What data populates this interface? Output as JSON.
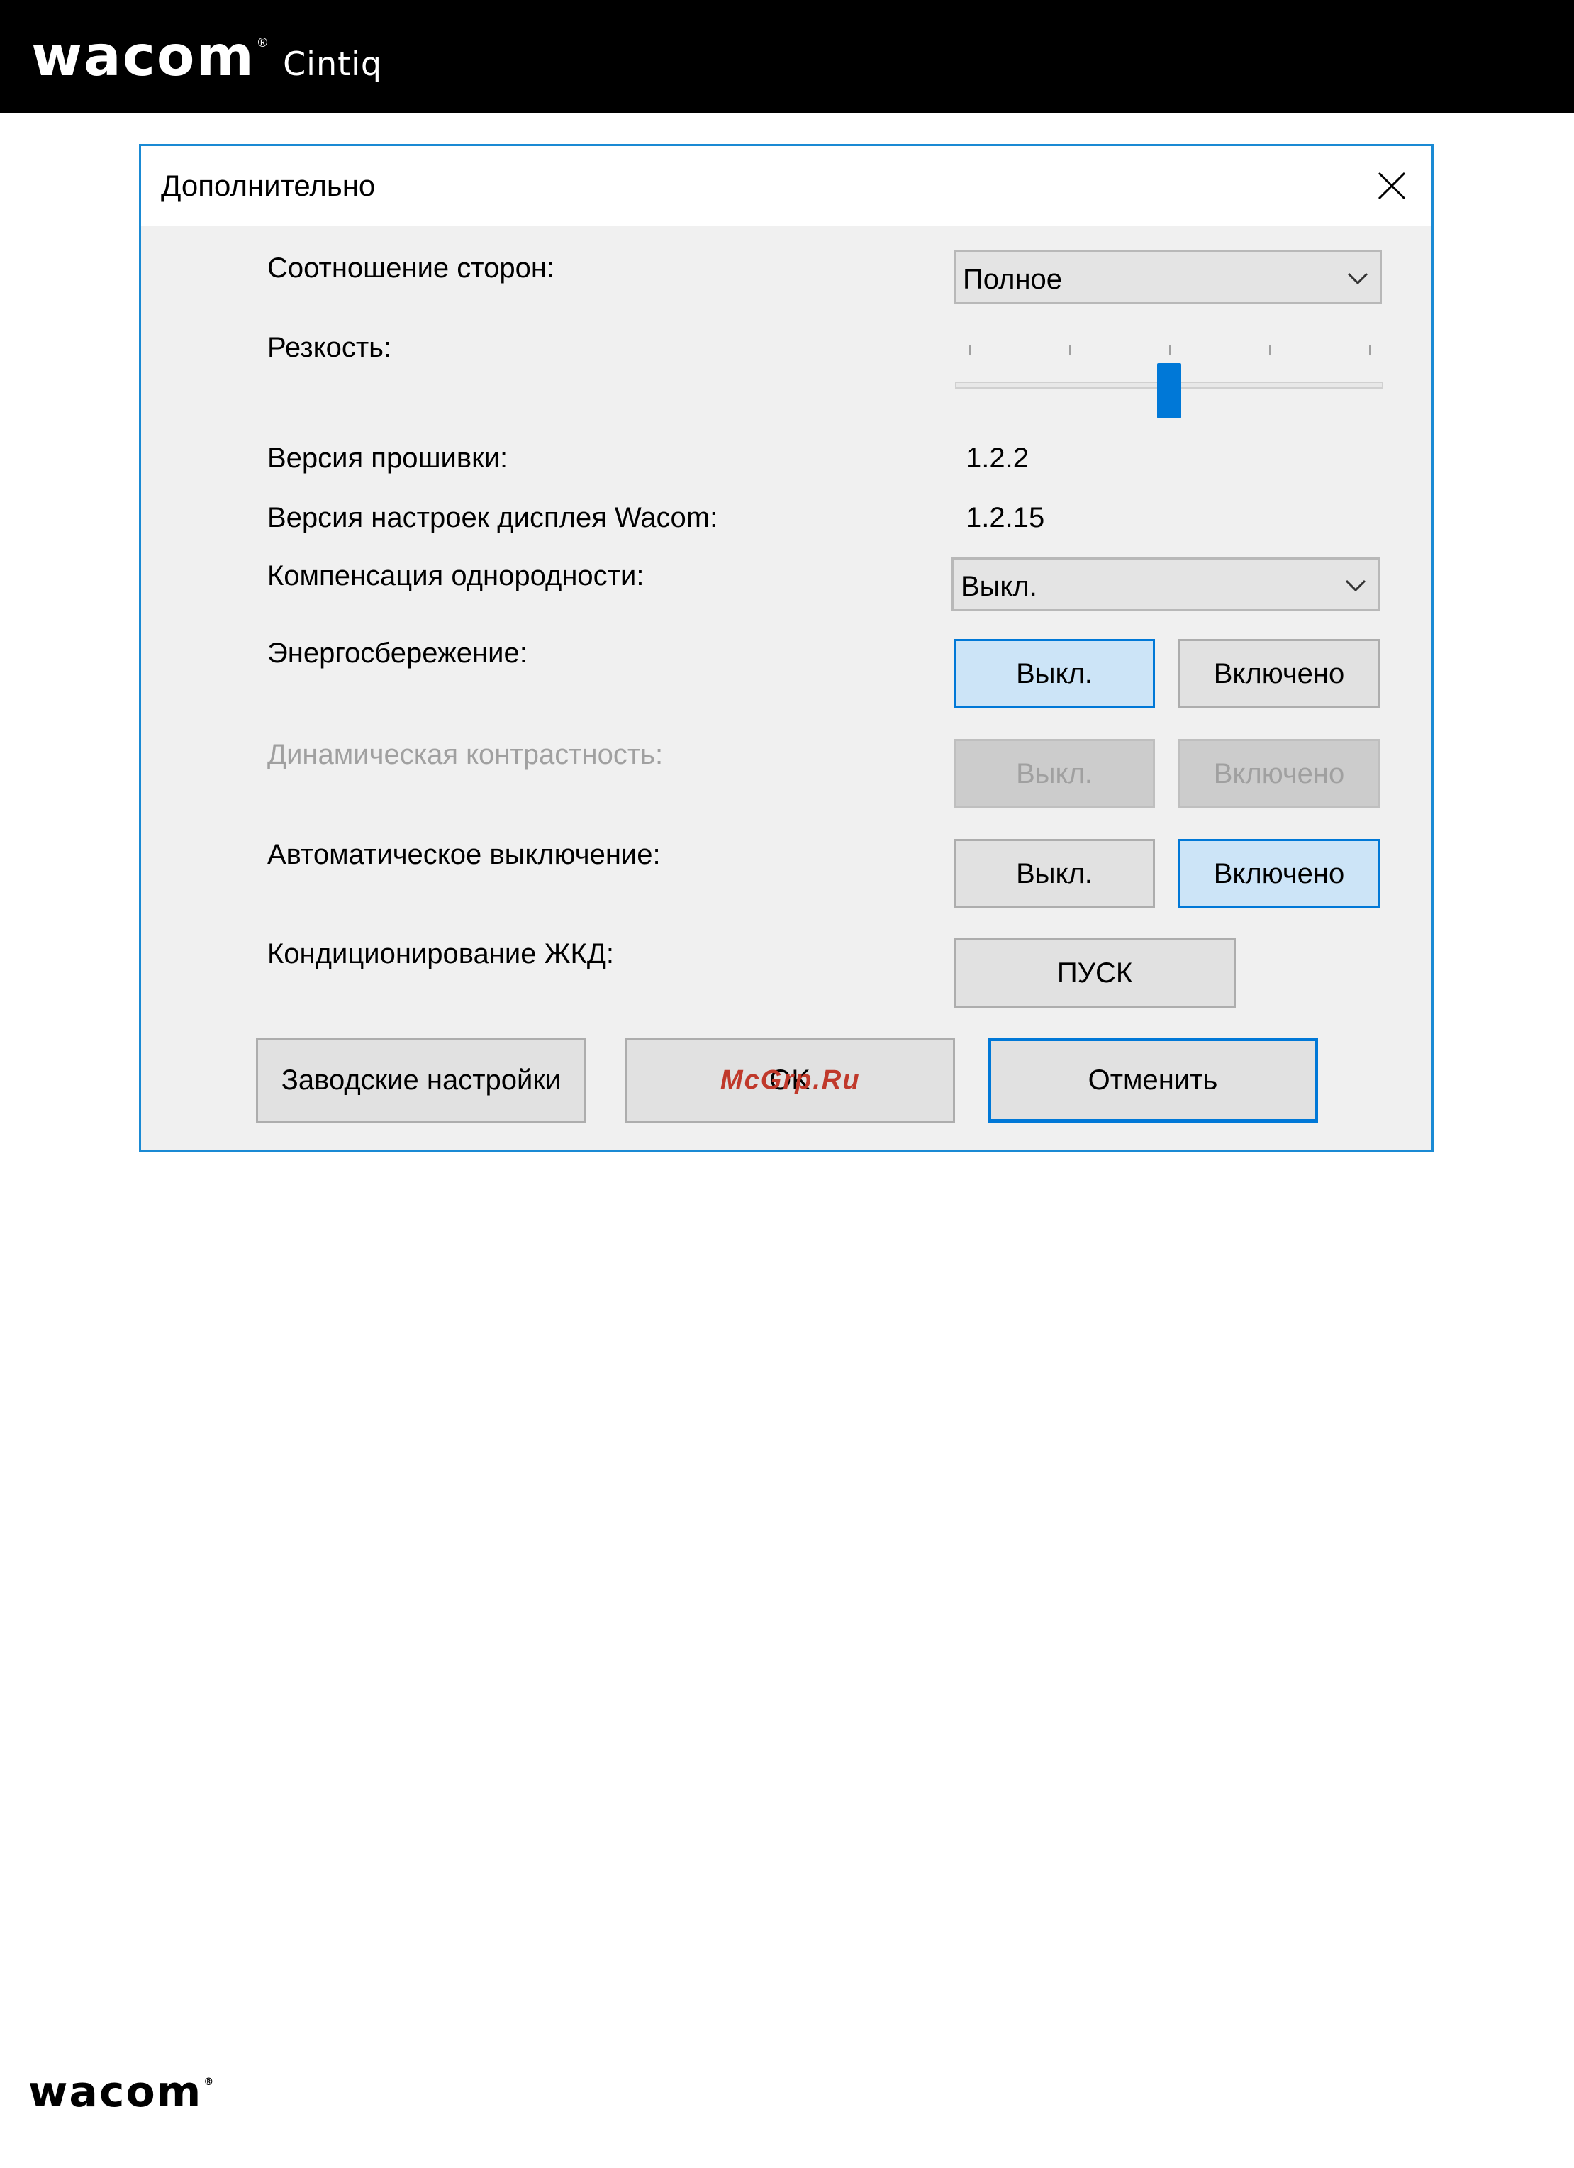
{
  "brand": {
    "logo": "wacom",
    "product": "Cintiq",
    "reg_mark": "®"
  },
  "dialog": {
    "title": "Дополнительно",
    "close_icon": "close-icon",
    "rows": {
      "aspect_ratio": {
        "label": "Соотношение сторон:",
        "value": "Полное"
      },
      "sharpness": {
        "label": "Резкость:",
        "level": 0.5,
        "ticks": 5
      },
      "firmware": {
        "label": "Версия прошивки:",
        "value": "1.2.2"
      },
      "settings_version": {
        "label": "Версия настроек дисплея Wacom:",
        "value": "1.2.15"
      },
      "uniformity": {
        "label": "Компенсация однородности:",
        "value": "Выкл."
      },
      "power_saving": {
        "label": "Энергосбережение:",
        "off": "Выкл.",
        "on": "Включено",
        "selected": "off"
      },
      "dynamic_contrast": {
        "label": "Динамическая контрастность:",
        "off": "Выкл.",
        "on": "Включено",
        "enabled": false
      },
      "auto_off": {
        "label": "Автоматическое выключение:",
        "off": "Выкл.",
        "on": "Включено",
        "selected": "on"
      },
      "lcd_conditioning": {
        "label": "Кондиционирование ЖКД:",
        "button": "ПУСК"
      }
    },
    "footer": {
      "factory_reset": "Заводские настройки",
      "ok": "OK",
      "cancel": "Отменить"
    }
  },
  "watermark": "McGrp.Ru",
  "footer_logo": "wacom",
  "colors": {
    "accent": "#0078d7",
    "selected_bg": "#cce4f7",
    "dialog_border": "#1a8ad4",
    "watermark": "#c0392b"
  }
}
